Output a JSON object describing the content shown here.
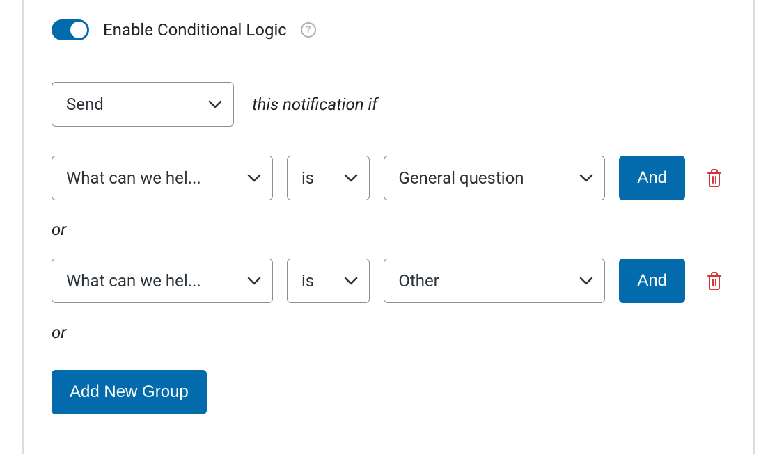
{
  "toggle": {
    "enabled": true,
    "label": "Enable Conditional Logic"
  },
  "action_row": {
    "action_select": "Send",
    "suffix_text": "this notification if"
  },
  "conditions": [
    {
      "field": "What can we hel...",
      "operator": "is",
      "value": "General question",
      "and_label": "And"
    },
    {
      "field": "What can we hel...",
      "operator": "is",
      "value": "Other",
      "and_label": "And"
    }
  ],
  "separator": "or",
  "add_group_label": "Add New Group"
}
